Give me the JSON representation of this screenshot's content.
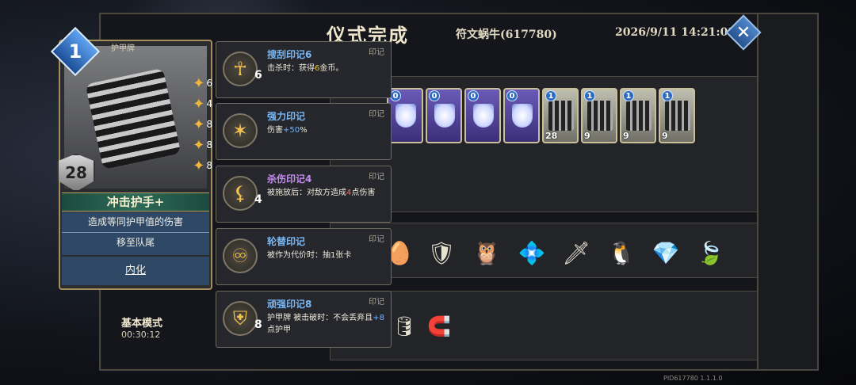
{
  "header": {
    "title": "仪式完成",
    "player": "符文蜗牛(617780)",
    "datetime": "2026/9/11 14:21:09",
    "close_label": "✕"
  },
  "card": {
    "type_label": "护甲牌",
    "cost": "1",
    "armor": "28",
    "name": "冲击护手+",
    "desc_line1": "造成等同护甲值的伤害",
    "desc_line2": "移至队尾",
    "keyword": "内化",
    "stacks": [
      "6",
      "4",
      "8",
      "8",
      "8"
    ]
  },
  "tooltips": [
    {
      "tag": "印记",
      "name": "搜刮印记6",
      "level": "6",
      "desc_a": "击杀时：获得",
      "desc_hl": "6",
      "desc_b": "金币。",
      "hl_class": "hl-gold",
      "name_class": ""
    },
    {
      "tag": "印记",
      "name": "强力印记",
      "level": "",
      "desc_a": "伤害",
      "desc_hl": "+50",
      "desc_b": "%",
      "hl_class": "hl-blue",
      "name_class": ""
    },
    {
      "tag": "印记",
      "name": "杀伤印记4",
      "level": "4",
      "desc_a": "被施放后：对敌方造成",
      "desc_hl": "4",
      "desc_b": "点伤害",
      "hl_class": "hl-red",
      "name_class": "purple"
    },
    {
      "tag": "印记",
      "name": "轮替印记",
      "level": "",
      "desc_a": "被作为代价时：抽1张卡",
      "desc_hl": "",
      "desc_b": "",
      "hl_class": "",
      "name_class": ""
    },
    {
      "tag": "印记",
      "name": "顽强印记8",
      "level": "8",
      "desc_a": "护甲牌 被击破时：不会丢弃且",
      "desc_hl": "+8",
      "desc_b": "点护甲",
      "hl_class": "hl-blue",
      "name_class": ""
    }
  ],
  "deck": [
    {
      "badge": "0",
      "kind": "purple",
      "armor": ""
    },
    {
      "badge": "0",
      "kind": "purple",
      "armor": ""
    },
    {
      "badge": "0",
      "kind": "purple",
      "armor": ""
    },
    {
      "badge": "0",
      "kind": "purple",
      "armor": ""
    },
    {
      "badge": "1",
      "kind": "gear",
      "armor": "28"
    },
    {
      "badge": "1",
      "kind": "gear",
      "armor": "9"
    },
    {
      "badge": "1",
      "kind": "gear",
      "armor": "9"
    },
    {
      "badge": "1",
      "kind": "gear",
      "armor": "9"
    }
  ],
  "relics": [
    "🥚",
    "🛡",
    "🦉",
    "💠",
    "🗡",
    "🐧",
    "💎",
    "🍃"
  ],
  "items": [
    "🪃",
    "🛢",
    "🧲"
  ],
  "footer": {
    "mode": "基本模式",
    "timer": "00:30:12",
    "pid": "PID617780  1.1.1.0"
  }
}
